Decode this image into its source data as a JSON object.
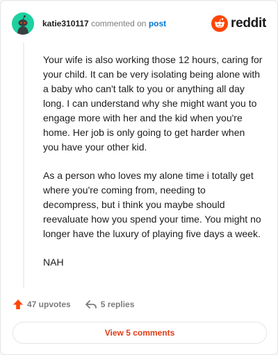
{
  "comment": {
    "author": "katie310117",
    "action_text": "commented on",
    "post_link": "post",
    "brand": "reddit",
    "paragraphs": [
      "Your wife is also working those 12 hours, caring for your child. It can be very isolating being alone with a baby who can't talk to you or anything all day long. I can understand why she might want you to engage more with her and the kid when you're home. Her job is only going to get harder when you have your other kid.",
      "As a person who loves my alone time i totally get where you're coming from, needing to decompress, but i think you maybe should reevaluate how you spend your time. You might no longer have the luxury of playing five days a week.",
      "NAH"
    ]
  },
  "actions": {
    "upvotes": "47 upvotes",
    "replies": "5 replies"
  },
  "footer": {
    "view_comments": "View 5 comments"
  },
  "colors": {
    "avatar": "#1fd1a0",
    "brand_orange": "#ff4500",
    "upvote": "#ff4500",
    "link_blue": "#0079d3",
    "view_button_text": "#e03a15"
  },
  "icons": {
    "avatar": "snoo-avatar-icon",
    "brand": "reddit-logo-icon",
    "upvote": "upvote-arrow-icon",
    "reply": "reply-arrow-icon"
  }
}
